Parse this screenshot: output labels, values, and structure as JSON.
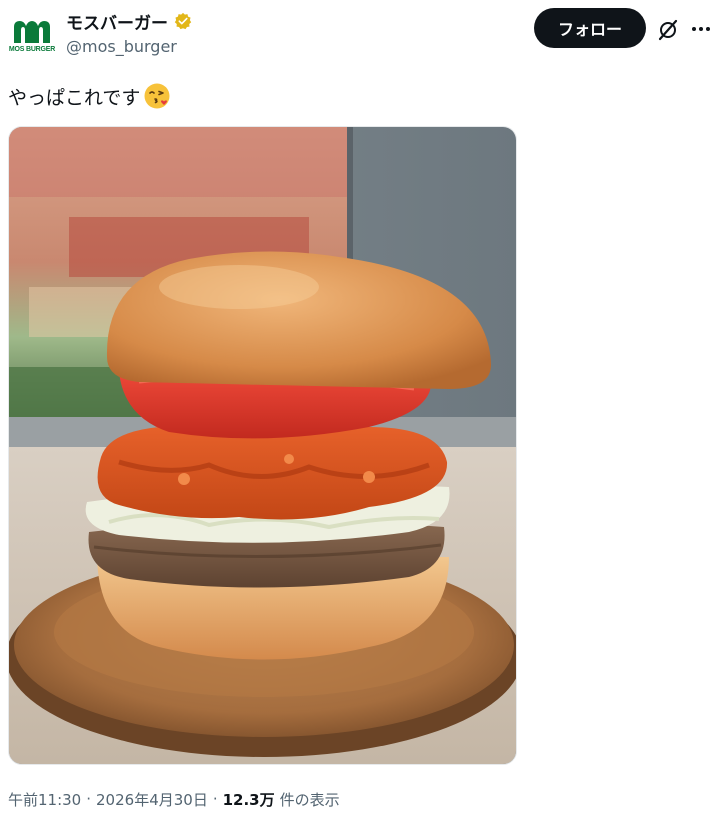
{
  "account": {
    "display_name": "モスバーガー",
    "handle": "@mos_burger",
    "avatar_text": "MOS BURGER",
    "verified_color": "#e2b719"
  },
  "header": {
    "follow_label": "フォロー"
  },
  "icons": {
    "grok": "grok-icon",
    "more": "more-icon"
  },
  "tweet": {
    "text": "やっぱこれです",
    "emoji": "face-blowing-kiss"
  },
  "media": {
    "description_icon": "photo"
  },
  "meta": {
    "time": "午前11:30",
    "sep1": "·",
    "date": "2026年4月30日",
    "sep2": "·",
    "views_count": "12.3万",
    "views_label": "件の表示"
  },
  "colors": {
    "brand_green": "#0a7a3a",
    "button_dark": "#0f1419",
    "secondary_text": "#536471"
  }
}
